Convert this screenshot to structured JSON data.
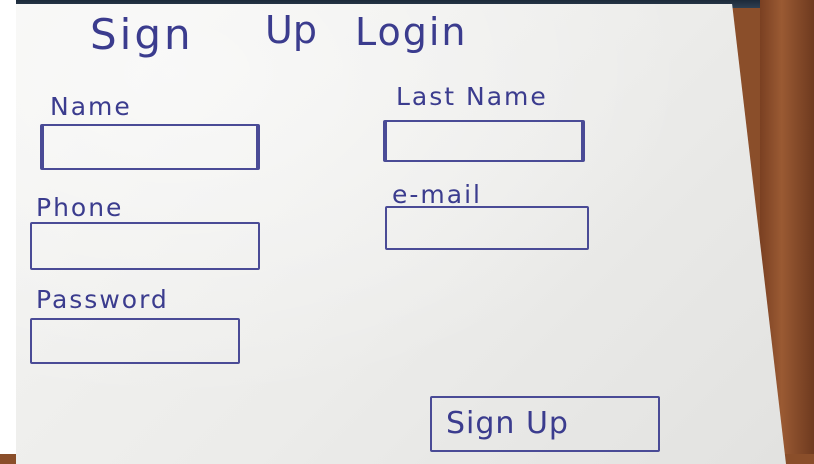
{
  "sketch": {
    "title_word_1": "Sign",
    "title_word_2": "Up",
    "title_word_3": "Login",
    "fields": {
      "name_label": "Name",
      "last_name_label": "Last Name",
      "phone_label": "Phone",
      "email_label": "e-mail",
      "password_label": "Password"
    },
    "submit_label": "Sign Up",
    "ink_color": "#3b3c8e",
    "paper_color": "#f0f0ee",
    "table_color": "#8a4e2a"
  }
}
